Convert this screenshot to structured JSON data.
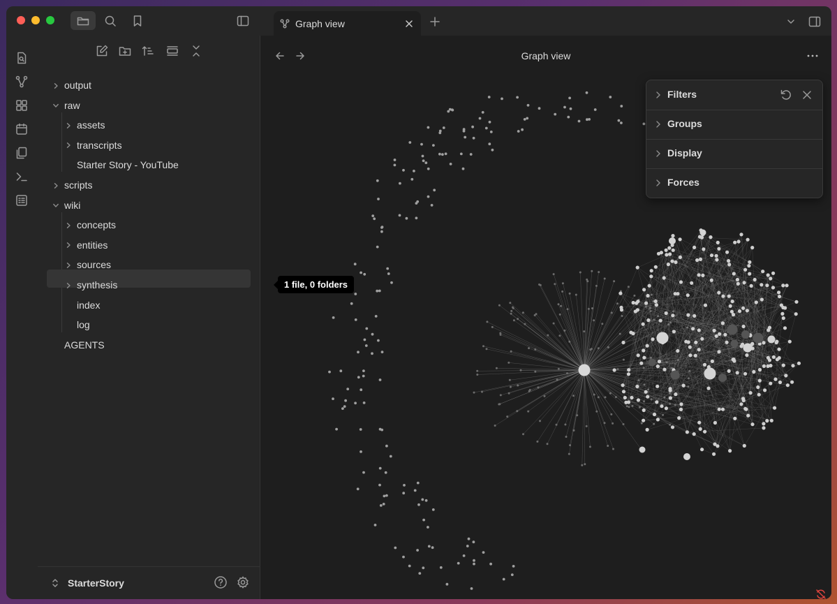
{
  "tab": {
    "title": "Graph view"
  },
  "view": {
    "title": "Graph view"
  },
  "tooltip": "1 file, 0 folders",
  "file_tree": [
    {
      "label": "output",
      "level": 0,
      "chevron": "right"
    },
    {
      "label": "raw",
      "level": 0,
      "chevron": "down"
    },
    {
      "label": "assets",
      "level": 1,
      "chevron": "right"
    },
    {
      "label": "transcripts",
      "level": 1,
      "chevron": "right"
    },
    {
      "label": "Starter Story - YouTube",
      "level": 1,
      "chevron": "none"
    },
    {
      "label": "scripts",
      "level": 0,
      "chevron": "right"
    },
    {
      "label": "wiki",
      "level": 0,
      "chevron": "down"
    },
    {
      "label": "concepts",
      "level": 1,
      "chevron": "right"
    },
    {
      "label": "entities",
      "level": 1,
      "chevron": "right"
    },
    {
      "label": "sources",
      "level": 1,
      "chevron": "right"
    },
    {
      "label": "synthesis",
      "level": 1,
      "chevron": "right",
      "selected": true
    },
    {
      "label": "index",
      "level": 1,
      "chevron": "none"
    },
    {
      "label": "log",
      "level": 1,
      "chevron": "none"
    },
    {
      "label": "AGENTS",
      "level": 0,
      "chevron": "none"
    }
  ],
  "vault": {
    "name": "StarterStory"
  },
  "graph_panel": {
    "sections": [
      "Filters",
      "Groups",
      "Display",
      "Forces"
    ]
  },
  "icons": {
    "titlebar": [
      "folder-icon",
      "search-icon",
      "bookmark-icon",
      "sidebar-toggle-icon"
    ],
    "ribbon": [
      "quick-switcher-icon",
      "graph-icon",
      "canvas-icon",
      "calendar-icon",
      "templates-icon",
      "terminal-icon",
      "command-palette-icon"
    ],
    "sidebar_tools": [
      "new-note-icon",
      "new-folder-icon",
      "sort-icon",
      "collapse-view-icon",
      "collapse-all-icon"
    ]
  },
  "colors": {
    "window_bg": "#1e1e1e",
    "chrome_bg": "#262626",
    "text": "#dcdcdc",
    "graph_node": "#a8a8a8",
    "sync_error": "#e0443e"
  }
}
